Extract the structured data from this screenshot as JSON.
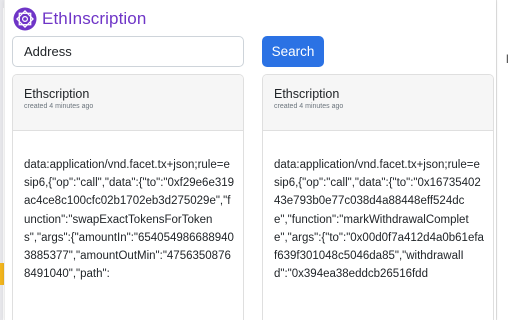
{
  "app": {
    "title": "EthInscription",
    "logo_icon": "ethscription-logo-icon",
    "brand_color": "#6f35c7"
  },
  "search": {
    "placeholder": "Address",
    "button_label": "Search",
    "button_color": "#2b72e4"
  },
  "background": {
    "right_edge_text": "l"
  },
  "cards": [
    {
      "title": "Ethscription",
      "time": "created 4 minutes ago",
      "content": "data:application/vnd.facet.tx+json;rule=esip6,{\"op\":\"call\",\"data\":{\"to\":\"0xf29e6e319ac4ce8c100cfc02b1702eb3d275029e\",\"function\":\"swapExactTokensForTokens\",\"args\":{\"amountIn\":\"6540549866889403885377\",\"amountOutMin\":\"47563508768491040\",\"path\":"
    },
    {
      "title": "Ethscription",
      "time": "created 4 minutes ago",
      "content": "data:application/vnd.facet.tx+json;rule=esip6,{\"op\":\"call\",\"data\":{\"to\":\"0x1673540243e793b0e77c038d4a88448eff524dce\",\"function\":\"markWithdrawalComplete\",\"args\":{\"to\":\"0x00d0f7a412d4a0b61efaf639f301048c5046da85\",\"withdrawalId\":\"0x394ea38eddcb26516fdd"
    }
  ]
}
